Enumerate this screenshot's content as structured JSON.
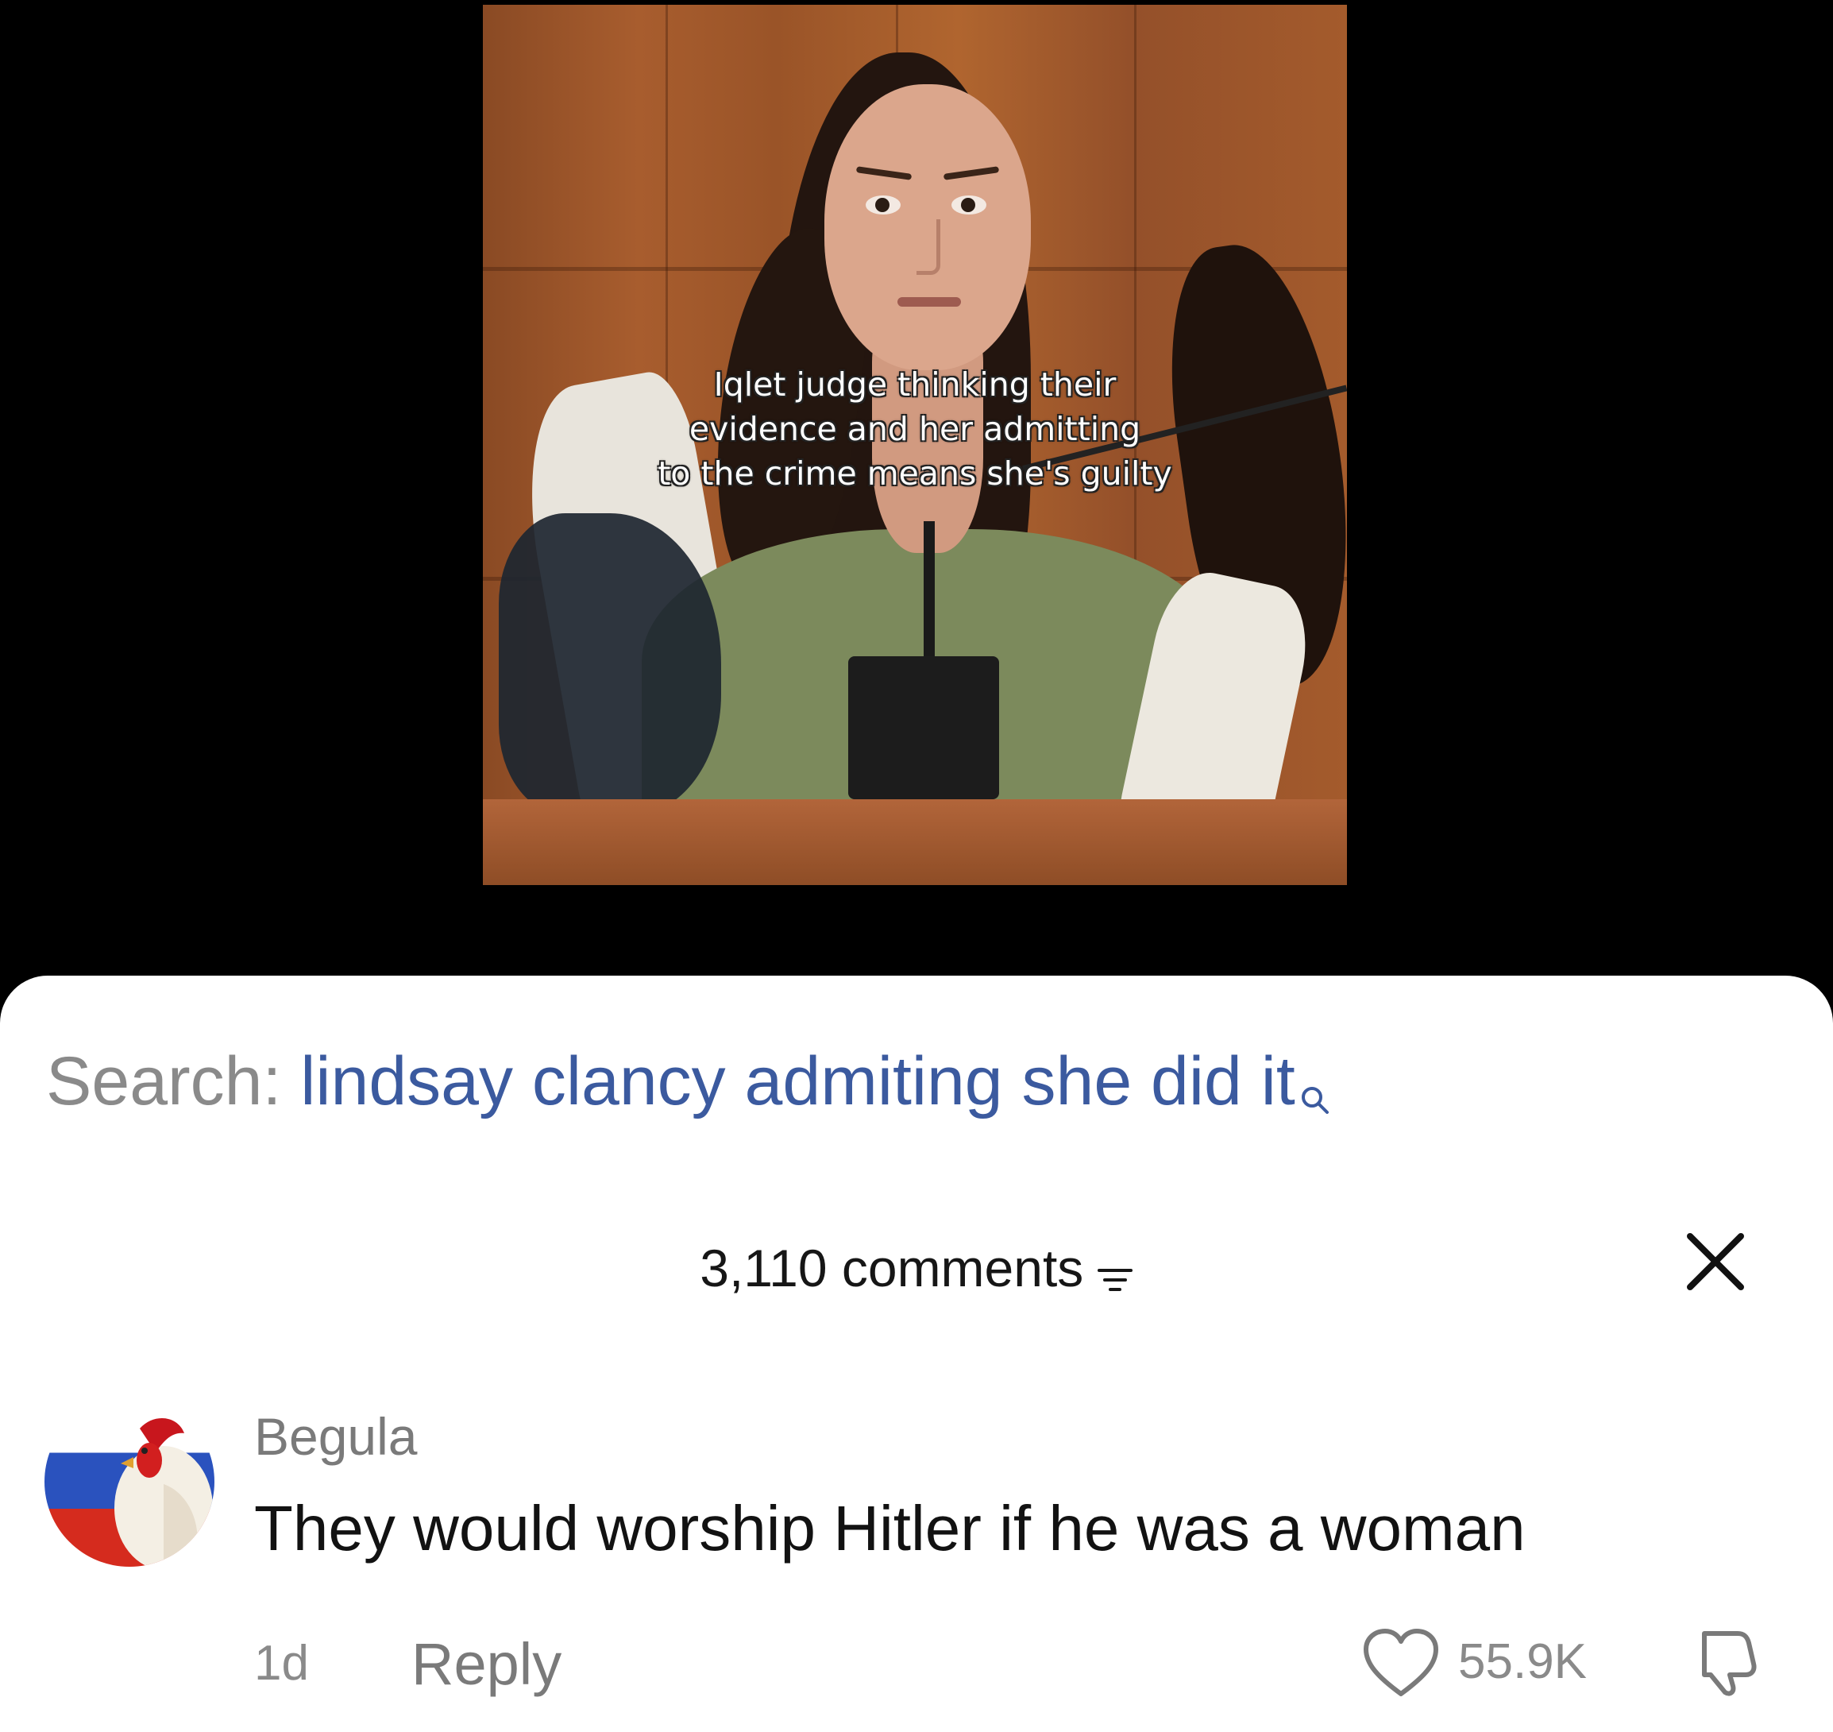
{
  "video": {
    "caption": "Iqlet judge thinking their\nevidence and her admitting\nto the crime means she's guilty"
  },
  "search": {
    "label": "Search:",
    "query": "lindsay clancy admiting she did it",
    "icon": "search-icon"
  },
  "comments_panel": {
    "count_label": "3,110 comments",
    "filter_icon": "filter-icon",
    "close_icon": "close-icon"
  },
  "comment": {
    "username": "Begula",
    "text": "They would worship Hitler if he was a woman",
    "time": "1d",
    "reply_label": "Reply",
    "like_count": "55.9K",
    "like_icon": "heart-icon",
    "dislike_icon": "thumbs-down-icon"
  },
  "colors": {
    "search_query": "#3b5a9f",
    "muted_text": "#8a8a8a",
    "sheet_background": "#ffffff",
    "video_background": "#000000"
  }
}
